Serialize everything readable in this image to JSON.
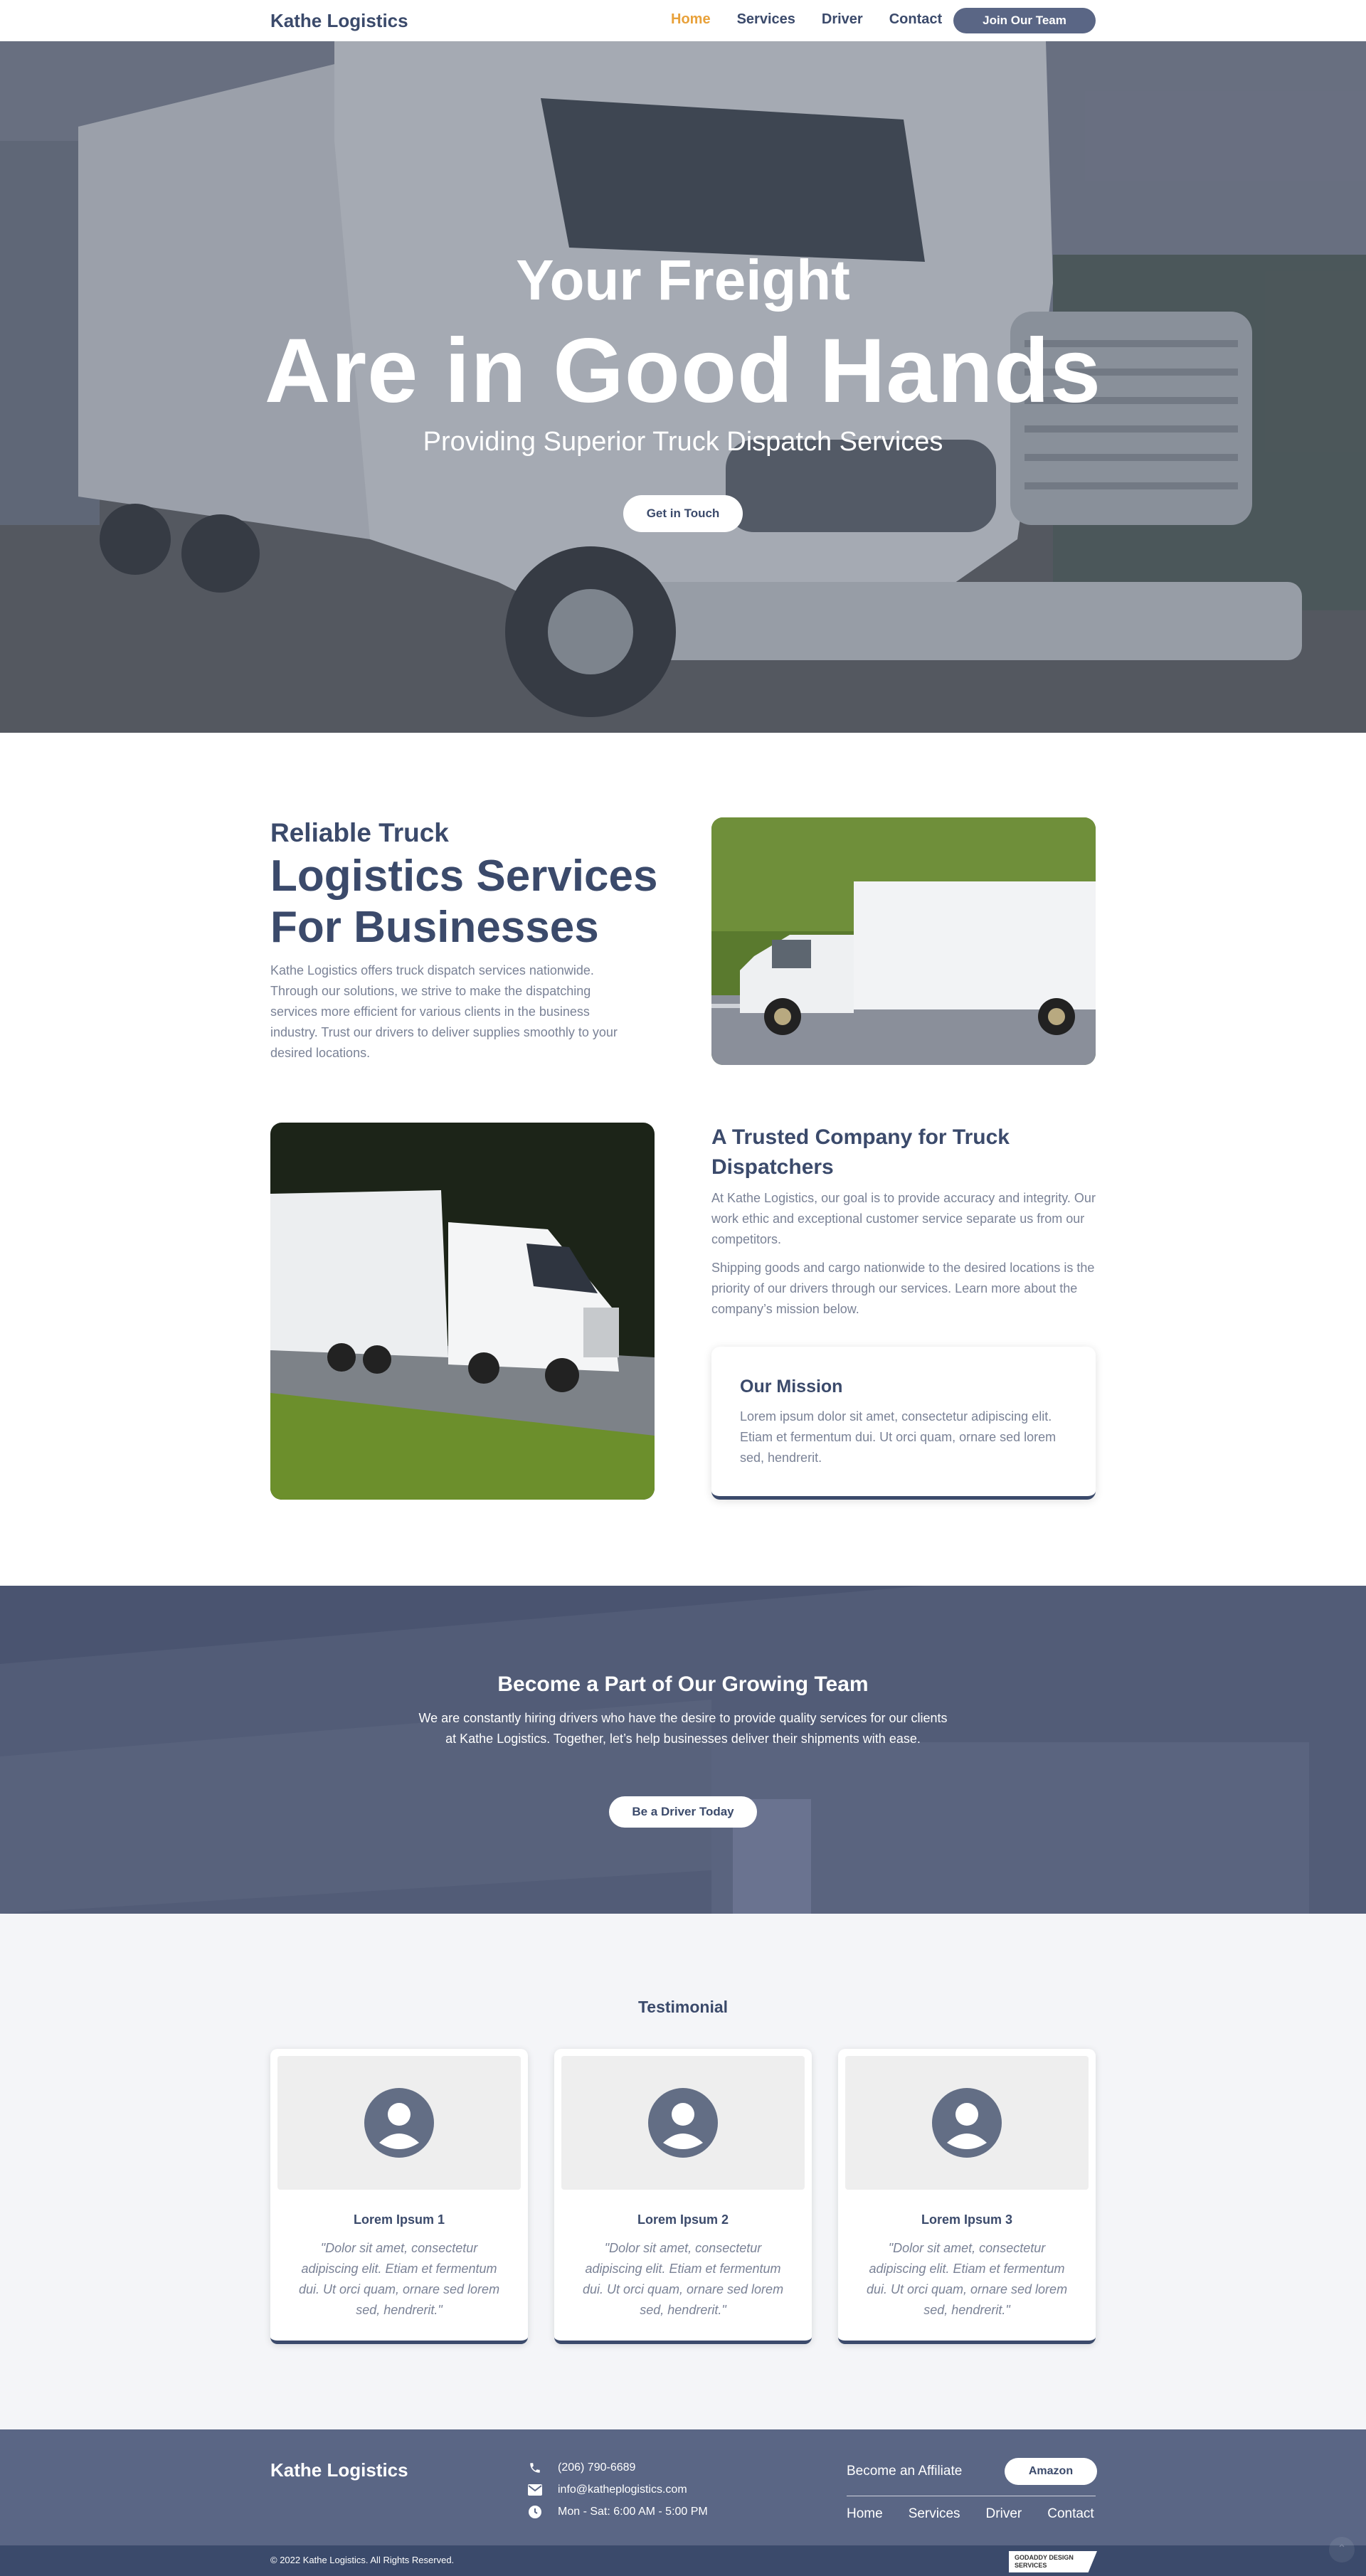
{
  "nav": {
    "logo": "Kathe Logistics",
    "items": [
      "Home",
      "Services",
      "Driver",
      "Contact"
    ],
    "join": "Join Our Team"
  },
  "hero": {
    "line1": "Your Freight",
    "line2": "Are in Good Hands",
    "subtitle": "Providing Superior Truck Dispatch Services",
    "cta": "Get in Touch"
  },
  "about": {
    "small": "Reliable Truck",
    "big": "Logistics Services For Businesses",
    "text": "Kathe Logistics offers truck dispatch services nationwide. Through our solutions, we strive to make the dispatching services more efficient for various clients in the business industry. Trust our drivers to deliver supplies smoothly to your desired locations."
  },
  "trusted": {
    "title": "A Trusted Company for Truck Dispatchers",
    "p1": "At Kathe Logistics, our goal is to provide accuracy and integrity. Our work ethic and exceptional customer service separate us from our competitors.",
    "p2": "Shipping goods and cargo nationwide to the desired locations is the priority of our drivers through our services. Learn more about the company’s mission below.",
    "mission_title": "Our Mission",
    "mission_text": "Lorem ipsum dolor sit amet, consectetur adipiscing elit. Etiam et fermentum dui. Ut orci quam, ornare sed lorem sed, hendrerit."
  },
  "banner": {
    "title": "Become a Part of Our Growing Team",
    "text": "We are constantly hiring drivers who have the desire to provide quality services for our clients at Kathe Logistics. Together, let’s help businesses deliver their shipments with ease.",
    "cta": "Be a Driver Today"
  },
  "testimonials": {
    "heading": "Testimonial",
    "items": [
      {
        "name": "Lorem Ipsum 1",
        "quote": "\"Dolor sit amet, consectetur adipiscing elit. Etiam et fermentum dui. Ut orci quam, ornare sed lorem sed, hendrerit.\""
      },
      {
        "name": "Lorem Ipsum 2",
        "quote": "\"Dolor sit amet, consectetur adipiscing elit. Etiam et fermentum dui. Ut orci quam, ornare sed lorem sed, hendrerit.\""
      },
      {
        "name": "Lorem Ipsum 3",
        "quote": "\"Dolor sit amet, consectetur adipiscing elit. Etiam et fermentum dui. Ut orci quam, ornare sed lorem sed, hendrerit.\""
      }
    ]
  },
  "footer": {
    "logo": "Kathe Logistics",
    "phone": "(206) 790-6689",
    "email": "info@katheplogistics.com",
    "hours": "Mon - Sat: 6:00 AM - 5:00 PM",
    "affiliate": "Become an Affiliate",
    "amazon": "Amazon",
    "links": [
      "Home",
      "Services",
      "Driver",
      "Contact"
    ],
    "copyright": "© 2022 Kathe Logistics. All Rights Reserved.",
    "badge": "GODADDY DESIGN SERVICES",
    "icons": [
      "phone-icon",
      "envelope-icon",
      "clock-icon"
    ]
  },
  "colors": {
    "primary": "#3b4a6b",
    "accent": "#e8a13a",
    "footer": "#5a6685",
    "muted_text": "#7a8296"
  }
}
